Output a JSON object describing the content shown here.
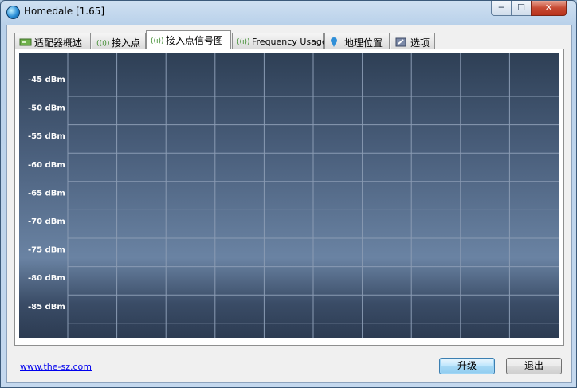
{
  "window": {
    "title": "Homedale [1.65]"
  },
  "controls": {
    "minimize": "─",
    "maximize": "☐",
    "close": "✕"
  },
  "tabs": [
    {
      "label": "适配器概述",
      "icon": "adapter-icon"
    },
    {
      "label": "接入点",
      "icon": "wireless-icon"
    },
    {
      "label": "接入点信号图",
      "icon": "wireless-icon",
      "active": true
    },
    {
      "label": "Frequency Usage",
      "icon": "wireless-icon"
    },
    {
      "label": "地理位置",
      "icon": "location-pin-icon"
    },
    {
      "label": "选项",
      "icon": "settings-icon"
    }
  ],
  "chart_data": {
    "type": "line",
    "title": "",
    "xlabel": "",
    "ylabel": "",
    "y_ticks": [
      "-45 dBm",
      "-50 dBm",
      "-55 dBm",
      "-60 dBm",
      "-65 dBm",
      "-70 dBm",
      "-75 dBm",
      "-80 dBm",
      "-85 dBm"
    ],
    "ylim": [
      -90,
      -40
    ],
    "grid": true,
    "vertical_grid_count": 10,
    "series": [],
    "colors": {
      "grid": "#8a9bb3",
      "label": "#ffffff"
    }
  },
  "footer": {
    "link": "www.the-sz.com",
    "update_button": "升级",
    "exit_button": "退出"
  }
}
